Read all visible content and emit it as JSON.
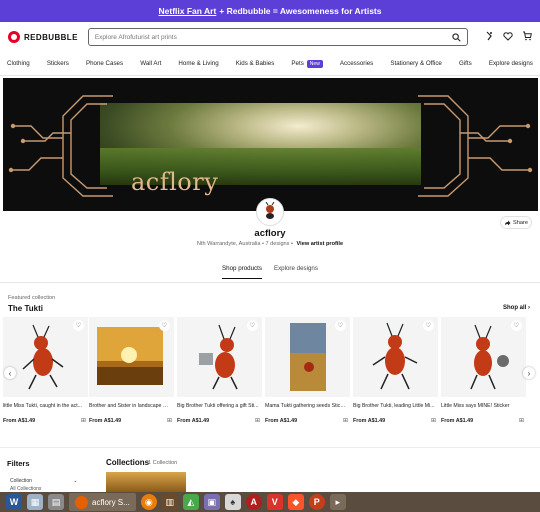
{
  "promo": {
    "link": "Netflix Fan Art",
    "rest": "+ Redbubble = Awesomeness for Artists"
  },
  "header": {
    "logo": "REDBUBBLE",
    "search_placeholder": "Explore Afrofuturist art prints"
  },
  "nav": {
    "items": [
      "Clothing",
      "Stickers",
      "Phone Cases",
      "Wall Art",
      "Home & Living",
      "Kids & Babies",
      "Pets",
      "Accessories",
      "Stationery & Office",
      "Gifts",
      "Explore designs"
    ],
    "new_badge": "New"
  },
  "banner": {
    "text": "acflory"
  },
  "artist": {
    "name": "acflory",
    "location": "Nth Warrandyte, Australia",
    "designs": "7 designs",
    "view_profile": "View artist profile",
    "share": "Share"
  },
  "tabs": [
    "Shop products",
    "Explore designs"
  ],
  "featured": {
    "label": "Featured collection",
    "title": "The Tukti",
    "shop_all": "Shop all"
  },
  "products": [
    {
      "title": "little Miss Tukti, caught in the act...",
      "price": "From A$1.49"
    },
    {
      "title": "Brother and Sister in landscape St...",
      "price": "From A$1.49"
    },
    {
      "title": "Big Brother Tukti offering a gift Sti...",
      "price": "From A$1.49"
    },
    {
      "title": "Mama Tukti gathering seeds Stick...",
      "price": "From A$1.49"
    },
    {
      "title": "Big Brother Tukti, leading Little Mi...",
      "price": "From A$1.49"
    },
    {
      "title": "Little Miss says MINE! Sticker",
      "price": "From A$1.49"
    }
  ],
  "filters": {
    "title": "Filters",
    "collection": "Collection",
    "all": "All Collections"
  },
  "collections": {
    "title": "Collections",
    "count": "1 Collection"
  },
  "taskbar": {
    "active_tab": "acflory S..."
  },
  "colors": {
    "promo": "#5b3fd6",
    "brand_red": "#e4002b",
    "banner_text": "#e2b98d",
    "taskbar": "#5a4c3e"
  }
}
